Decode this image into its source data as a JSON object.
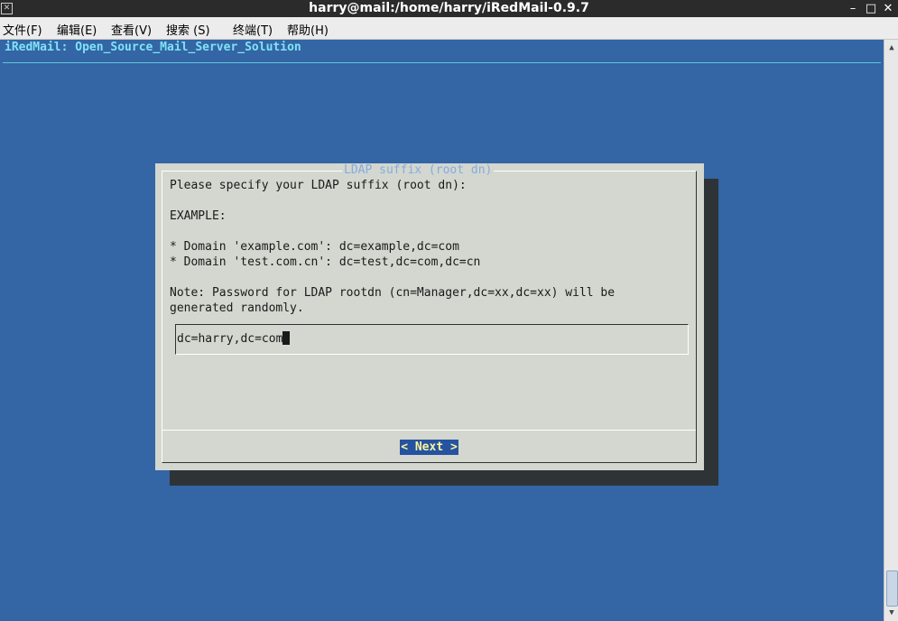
{
  "window": {
    "title": "harry@mail:/home/harry/iRedMail-0.9.7"
  },
  "menubar": [
    "文件(F)",
    "编辑(E)",
    "查看(V)",
    "搜索 (S)",
    "终端(T)",
    "帮助(H)"
  ],
  "terminal": {
    "backtitle": "iRedMail: Open_Source_Mail_Server_Solution",
    "dialog": {
      "title": "LDAP suffix (root dn)",
      "lines": [
        "Please specify your LDAP suffix (root dn):",
        "EXAMPLE:",
        "* Domain 'example.com': dc=example,dc=com",
        "* Domain 'test.com.cn': dc=test,dc=com,dc=cn",
        "Note: Password for LDAP rootdn (cn=Manager,dc=xx,dc=xx) will be",
        "generated randomly."
      ],
      "input_value": "dc=harry,dc=com",
      "button": "< Next >"
    }
  },
  "colors": {
    "terminal_bg": "#3465a4",
    "dialog_bg": "#d3d7cf",
    "button_bg": "#2553a0",
    "button_text": "#fcf59a",
    "backtitle": "#7fe3f6"
  }
}
